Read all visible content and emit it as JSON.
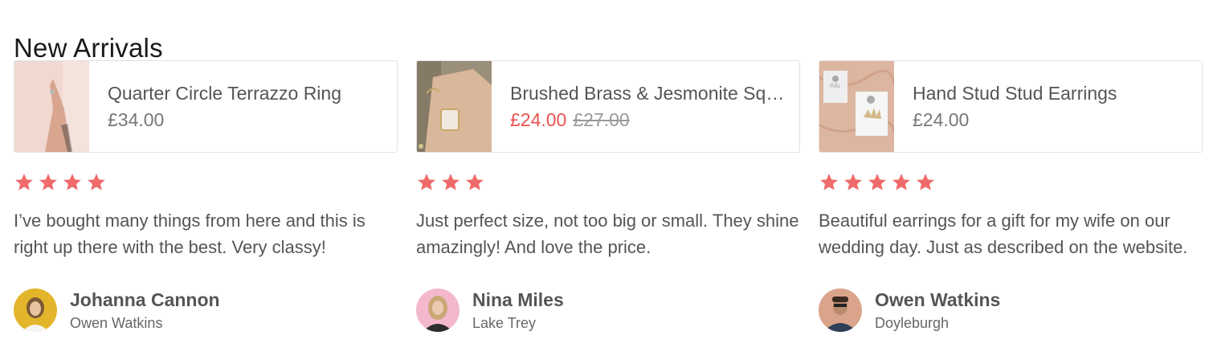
{
  "section": {
    "title": "New Arrivals"
  },
  "colors": {
    "accent": "#e8524f",
    "star": "#ef6b6b",
    "text": "#555555",
    "border": "#e2e2e2"
  },
  "reviews": [
    {
      "product": {
        "name": "Quarter Circle Terrazzo Ring",
        "price": "£34.00",
        "old_price": ""
      },
      "rating": 4,
      "text": "I’ve bought many things from here and this is right up there with the best. Very classy!",
      "author": {
        "name": "Johanna Cannon",
        "location": "Owen Watkins"
      }
    },
    {
      "product": {
        "name": "Brushed Brass & Jesmonite Squ...",
        "price": "£24.00",
        "old_price": "£27.00"
      },
      "rating": 3,
      "text": "Just perfect size, not too big or small. They shine amazingly! And love the price.",
      "author": {
        "name": "Nina Miles",
        "location": "Lake Trey"
      }
    },
    {
      "product": {
        "name": "Hand Stud Stud Earrings",
        "price": "£24.00",
        "old_price": ""
      },
      "rating": 5,
      "text": "Beautiful earrings for a gift for my wife on our wedding day. Just as described on the website.",
      "author": {
        "name": "Owen Watkins",
        "location": "Doyleburgh"
      }
    }
  ]
}
